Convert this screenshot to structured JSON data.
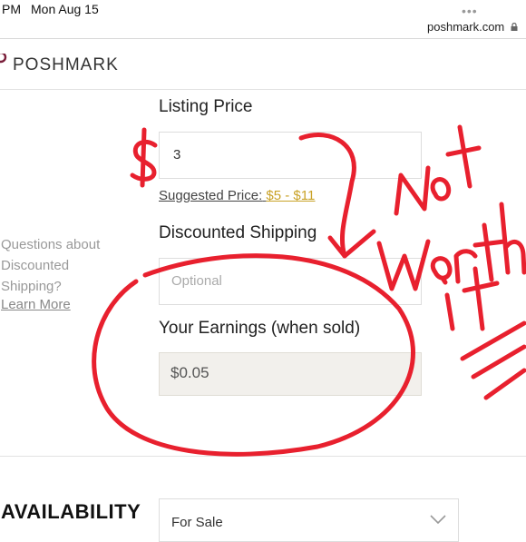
{
  "status_bar": {
    "time": "PM",
    "date": "Mon Aug 15",
    "url": "poshmark.com",
    "more_icon": "more-dots-icon",
    "lock_icon": "lock-icon"
  },
  "nav": {
    "logo_text": "POSHMARK"
  },
  "listing": {
    "price_label": "Listing Price",
    "price_value": "3",
    "suggested_prefix": "Suggested Price:",
    "suggested_range": "$5 - $11",
    "suggested_color": "#c9a227"
  },
  "shipping": {
    "label": "Discounted Shipping",
    "placeholder": "Optional",
    "help_lines": [
      "Questions about",
      "Discounted",
      "Shipping?"
    ],
    "learn_more": "Learn More"
  },
  "earnings": {
    "label": "Your Earnings (when sold)",
    "value": "$0.05",
    "field_bg": "#f2f0ec"
  },
  "availability": {
    "label": "AVAILABILITY",
    "value": "For Sale",
    "chevron_icon": "chevron-down-icon"
  },
  "annotations": {
    "dollar": "$",
    "note": "Not worth it",
    "ink_color": "#e8202e"
  }
}
